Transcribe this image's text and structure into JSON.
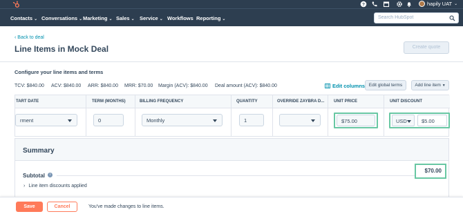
{
  "topbar": {
    "account_name": "hapily UAT",
    "icons": [
      "help-icon",
      "calling-icon",
      "marketplace-icon",
      "settings-icon",
      "notifications-icon"
    ]
  },
  "nav": {
    "items": [
      {
        "label": "Contacts"
      },
      {
        "label": "Conversations"
      },
      {
        "label": "Marketing"
      },
      {
        "label": "Sales"
      },
      {
        "label": "Service"
      },
      {
        "label": "Workflows"
      },
      {
        "label": "Reporting"
      }
    ],
    "search_placeholder": "Search HubSpot"
  },
  "header": {
    "back_link": "Back to deal",
    "title": "Line Items in Mock Deal",
    "create_quote": "Create quote"
  },
  "content": {
    "section_title": "Configure your line items and terms",
    "metrics": [
      "TCV: $840.00",
      "ACV: $840.00",
      "ARR: $840.00",
      "MRR: $70.00",
      "Margin (ACV): $840.00",
      "Deal amount (ACV): $840.00"
    ],
    "edit_columns": "Edit columns",
    "edit_global_terms": "Edit global terms",
    "add_line_item": "Add line item"
  },
  "table": {
    "headers": [
      "TART DATE",
      "TERM (MONTHS)",
      "BILLING FREQUENCY",
      "QUANTITY",
      "OVERRIDE ZAYBRA D...",
      "UNIT PRICE",
      "UNIT DISCOUNT"
    ],
    "row": {
      "start_date": "rment",
      "term": "0",
      "billing_frequency": "Monthly",
      "quantity": "1",
      "override": "",
      "unit_price": "$75.00",
      "discount_currency": "USD",
      "discount_value": "$5.00"
    }
  },
  "summary": {
    "title": "Summary",
    "subtotal_label": "Subtotal",
    "subtotal_value": "$70.00",
    "discounts_label": "Line item discounts applied"
  },
  "footer": {
    "save": "Save",
    "cancel": "Cancel",
    "message": "You've made changes to line items."
  },
  "colors": {
    "nav_bg": "#2d3e50",
    "accent": "#ff7a59",
    "link": "#0091ae",
    "highlight": "#68c7a3"
  }
}
